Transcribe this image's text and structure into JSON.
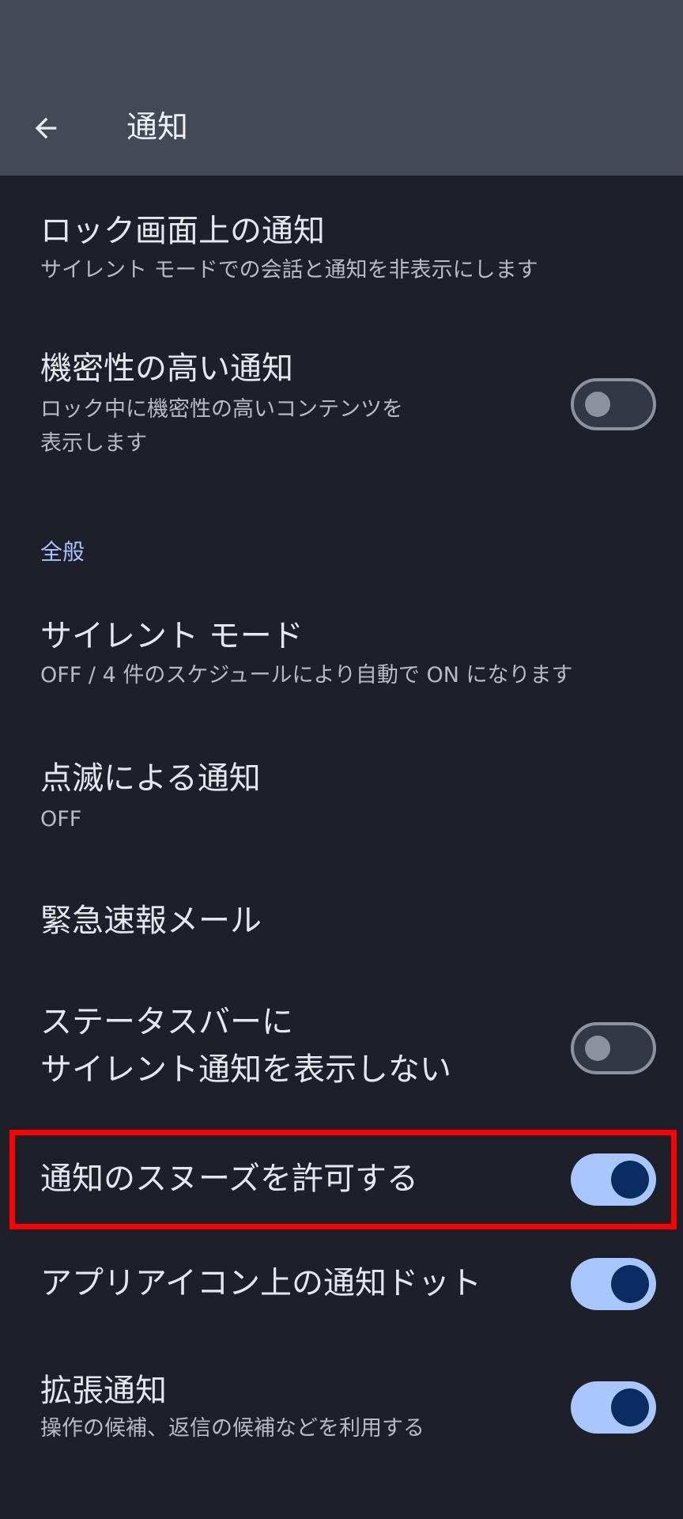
{
  "header": {
    "title": "通知",
    "back_icon": "arrow-left-icon"
  },
  "lock_screen": {
    "title": "ロック画面上の通知",
    "summary": "サイレント モードでの会話と通知を非表示にします"
  },
  "sensitive": {
    "title": "機密性の高い通知",
    "summary_line1": "ロック中に機密性の高いコンテンツを",
    "summary_line2": "表示します",
    "checked": false
  },
  "general": {
    "header": "全般"
  },
  "dnd": {
    "title": "サイレント モード",
    "summary": "OFF / 4 件のスケジュールにより自動で ON になります"
  },
  "flash": {
    "title": "点滅による通知",
    "summary": "OFF"
  },
  "emergency": {
    "title": "緊急速報メール"
  },
  "silent_status": {
    "title_line1": "ステータスバーに",
    "title_line2": "サイレント通知を表示しない",
    "checked": false
  },
  "snooze": {
    "title": "通知のスヌーズを許可する",
    "checked": true
  },
  "dots": {
    "title": "アプリアイコン上の通知ドット",
    "checked": true
  },
  "enhanced": {
    "title": "拡張通知",
    "summary": "操作の候補、返信の候補などを利用する",
    "checked": true
  },
  "colors": {
    "toolbar_bg": "#434955",
    "page_bg": "#1d2029",
    "accent": "#a9c2ff",
    "switch_on_track": "#a9c6ff",
    "switch_on_thumb": "#0a2c63",
    "highlight": "#ff0000"
  }
}
